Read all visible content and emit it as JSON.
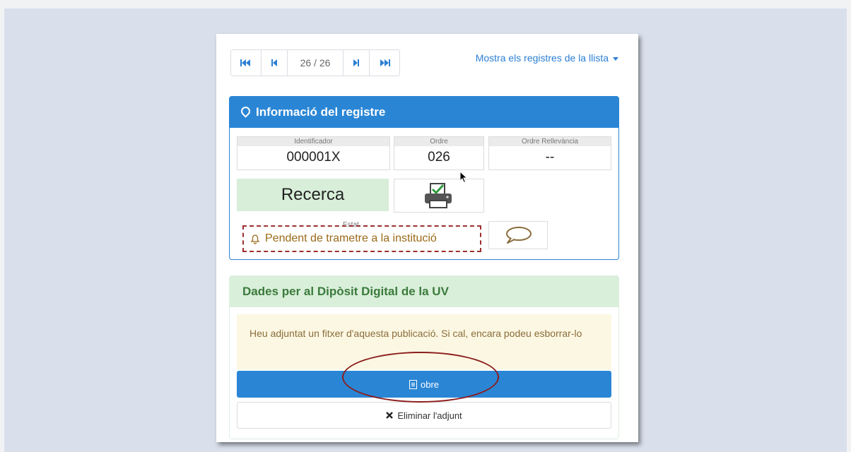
{
  "pager": {
    "first_icon": "first-page-icon",
    "prev_icon": "previous-page-icon",
    "count": "26 / 26",
    "next_icon": "next-page-icon",
    "last_icon": "last-page-icon"
  },
  "list_link": "Mostra els registres de la llista",
  "info_panel": {
    "title": "Informació del registre",
    "identificador_label": "Identificador",
    "identificador_value": "000001X",
    "ordre_label": "Ordre",
    "ordre_value": "026",
    "relevancia_label": "Ordre Rellevància",
    "relevancia_value": "--",
    "tipus": "Recerca",
    "estat_label": "Estat",
    "estat_value": "Pendent de trametre a la institució"
  },
  "dipòsit_panel": {
    "title": "Dades per al Dipòsit Digital de la UV",
    "message": "Heu adjuntat un fitxer d'aquesta publicació. Si cal, encara podeu esborrar-lo",
    "open_button": "obre",
    "remove_button": "Eliminar l'adjunt"
  },
  "colors": {
    "primary": "#2a86d5",
    "success_bg": "#d9efda",
    "warning_bg": "#fcf7e2",
    "highlight": "#9b2f2f"
  }
}
